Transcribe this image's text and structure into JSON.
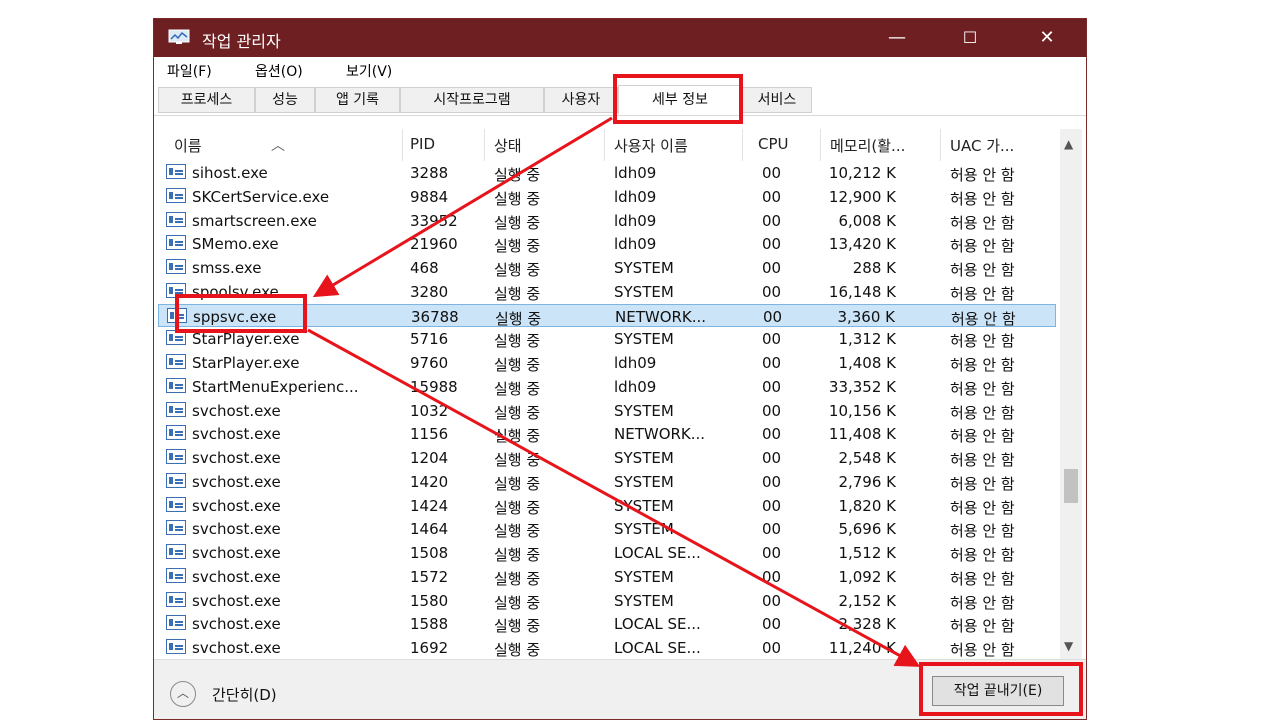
{
  "window": {
    "title": "작업 관리자",
    "minimize": "—",
    "maximize": "☐",
    "close": "✕"
  },
  "menu": [
    "파일(F)",
    "옵션(O)",
    "보기(V)"
  ],
  "tabs": [
    "프로세스",
    "성능",
    "앱 기록",
    "시작프로그램",
    "사용자",
    "세부 정보",
    "서비스"
  ],
  "active_tab": "세부 정보",
  "columns": [
    "이름",
    "PID",
    "상태",
    "사용자 이름",
    "CPU",
    "메모리(활...",
    "UAC 가..."
  ],
  "rows": [
    {
      "name": "sihost.exe",
      "pid": "3288",
      "status": "실행 중",
      "user": "ldh09",
      "cpu": "00",
      "mem": "10,212 K",
      "uac": "허용 안 함"
    },
    {
      "name": "SKCertService.exe",
      "pid": "9884",
      "status": "실행 중",
      "user": "ldh09",
      "cpu": "00",
      "mem": "12,900 K",
      "uac": "허용 안 함"
    },
    {
      "name": "smartscreen.exe",
      "pid": "33952",
      "status": "실행 중",
      "user": "ldh09",
      "cpu": "00",
      "mem": "6,008 K",
      "uac": "허용 안 함"
    },
    {
      "name": "SMemo.exe",
      "pid": "21960",
      "status": "실행 중",
      "user": "ldh09",
      "cpu": "00",
      "mem": "13,420 K",
      "uac": "허용 안 함"
    },
    {
      "name": "smss.exe",
      "pid": "468",
      "status": "실행 중",
      "user": "SYSTEM",
      "cpu": "00",
      "mem": "288 K",
      "uac": "허용 안 함"
    },
    {
      "name": "spoolsv.exe",
      "pid": "3280",
      "status": "실행 중",
      "user": "SYSTEM",
      "cpu": "00",
      "mem": "16,148 K",
      "uac": "허용 안 함"
    },
    {
      "name": "sppsvc.exe",
      "pid": "36788",
      "status": "실행 중",
      "user": "NETWORK...",
      "cpu": "00",
      "mem": "3,360 K",
      "uac": "허용 안 함",
      "selected": true
    },
    {
      "name": "StarPlayer.exe",
      "pid": "5716",
      "status": "실행 중",
      "user": "SYSTEM",
      "cpu": "00",
      "mem": "1,312 K",
      "uac": "허용 안 함"
    },
    {
      "name": "StarPlayer.exe",
      "pid": "9760",
      "status": "실행 중",
      "user": "ldh09",
      "cpu": "00",
      "mem": "1,408 K",
      "uac": "허용 안 함"
    },
    {
      "name": "StartMenuExperienc...",
      "pid": "15988",
      "status": "실행 중",
      "user": "ldh09",
      "cpu": "00",
      "mem": "33,352 K",
      "uac": "허용 안 함"
    },
    {
      "name": "svchost.exe",
      "pid": "1032",
      "status": "실행 중",
      "user": "SYSTEM",
      "cpu": "00",
      "mem": "10,156 K",
      "uac": "허용 안 함"
    },
    {
      "name": "svchost.exe",
      "pid": "1156",
      "status": "실행 중",
      "user": "NETWORK...",
      "cpu": "00",
      "mem": "11,408 K",
      "uac": "허용 안 함"
    },
    {
      "name": "svchost.exe",
      "pid": "1204",
      "status": "실행 중",
      "user": "SYSTEM",
      "cpu": "00",
      "mem": "2,548 K",
      "uac": "허용 안 함"
    },
    {
      "name": "svchost.exe",
      "pid": "1420",
      "status": "실행 중",
      "user": "SYSTEM",
      "cpu": "00",
      "mem": "2,796 K",
      "uac": "허용 안 함"
    },
    {
      "name": "svchost.exe",
      "pid": "1424",
      "status": "실행 중",
      "user": "SYSTEM",
      "cpu": "00",
      "mem": "1,820 K",
      "uac": "허용 안 함"
    },
    {
      "name": "svchost.exe",
      "pid": "1464",
      "status": "실행 중",
      "user": "SYSTEM",
      "cpu": "00",
      "mem": "5,696 K",
      "uac": "허용 안 함"
    },
    {
      "name": "svchost.exe",
      "pid": "1508",
      "status": "실행 중",
      "user": "LOCAL SE...",
      "cpu": "00",
      "mem": "1,512 K",
      "uac": "허용 안 함"
    },
    {
      "name": "svchost.exe",
      "pid": "1572",
      "status": "실행 중",
      "user": "SYSTEM",
      "cpu": "00",
      "mem": "1,092 K",
      "uac": "허용 안 함"
    },
    {
      "name": "svchost.exe",
      "pid": "1580",
      "status": "실행 중",
      "user": "SYSTEM",
      "cpu": "00",
      "mem": "2,152 K",
      "uac": "허용 안 함"
    },
    {
      "name": "svchost.exe",
      "pid": "1588",
      "status": "실행 중",
      "user": "LOCAL SE...",
      "cpu": "00",
      "mem": "2,328 K",
      "uac": "허용 안 함"
    },
    {
      "name": "svchost.exe",
      "pid": "1692",
      "status": "실행 중",
      "user": "LOCAL SE...",
      "cpu": "00",
      "mem": "11,240 K",
      "uac": "허용 안 함"
    }
  ],
  "footer": {
    "less_label": "간단히(D)",
    "end_task_label": "작업 끝내기(E)"
  },
  "colors": {
    "titlebar": "#6e1f22",
    "annotation": "#e8141b",
    "selection": "#cce4f7"
  }
}
